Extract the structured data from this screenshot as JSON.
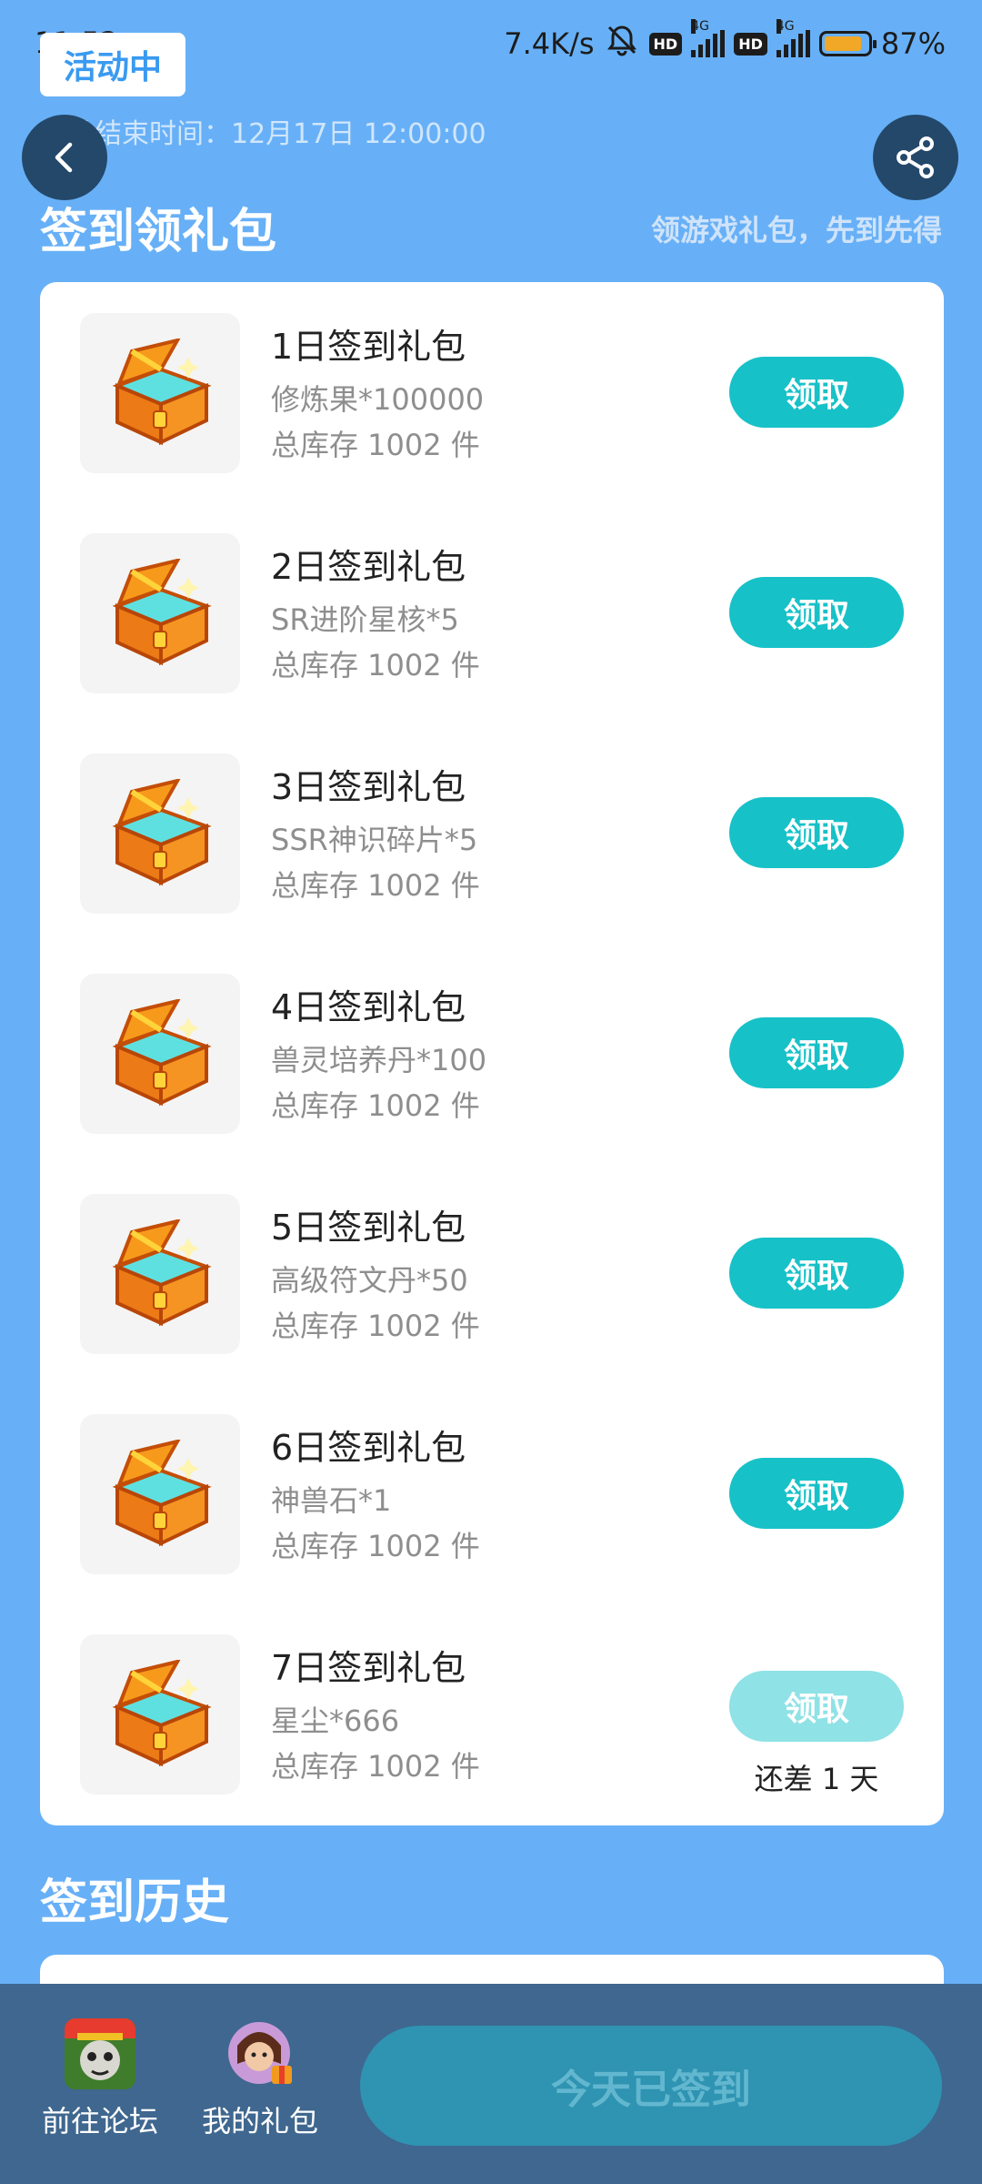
{
  "status_bar": {
    "time": "11:52",
    "net_speed": "7.4K/s",
    "hd1": "HD",
    "hd2": "HD",
    "net1": "4G",
    "net2": "4G",
    "battery": "87%",
    "battery_level": 0.87
  },
  "header": {
    "activity_tag": "活动中",
    "end_time": "活动结束时间：12月17日 12:00:00"
  },
  "signin_section": {
    "title": "签到领礼包",
    "subtitle": "领游戏礼包，先到先得"
  },
  "gifts": [
    {
      "name": "1日签到礼包",
      "item": "修炼果*100000",
      "stock": "总库存 1002 件",
      "button": "领取",
      "enabled": true
    },
    {
      "name": "2日签到礼包",
      "item": "SR进阶星核*5",
      "stock": "总库存 1002 件",
      "button": "领取",
      "enabled": true
    },
    {
      "name": "3日签到礼包",
      "item": "SSR神识碎片*5",
      "stock": "总库存 1002 件",
      "button": "领取",
      "enabled": true
    },
    {
      "name": "4日签到礼包",
      "item": "兽灵培养丹*100",
      "stock": "总库存 1002 件",
      "button": "领取",
      "enabled": true
    },
    {
      "name": "5日签到礼包",
      "item": "高级符文丹*50",
      "stock": "总库存 1002 件",
      "button": "领取",
      "enabled": true
    },
    {
      "name": "6日签到礼包",
      "item": "神兽石*1",
      "stock": "总库存 1002 件",
      "button": "领取",
      "enabled": true
    },
    {
      "name": "7日签到礼包",
      "item": "星尘*666",
      "stock": "总库存 1002 件",
      "button": "领取",
      "enabled": false,
      "remaining": "还差 1 天"
    }
  ],
  "history_section": {
    "title": "签到历史"
  },
  "bottom_bar": {
    "forum_label": "前往论坛",
    "my_gifts_label": "我的礼包",
    "signed_label": "今天已签到"
  },
  "colors": {
    "background": "#67b0f7",
    "claim_button": "#17c1c8",
    "claim_button_disabled": "#8fe2e6",
    "bottom_bar": "#3f678f"
  }
}
